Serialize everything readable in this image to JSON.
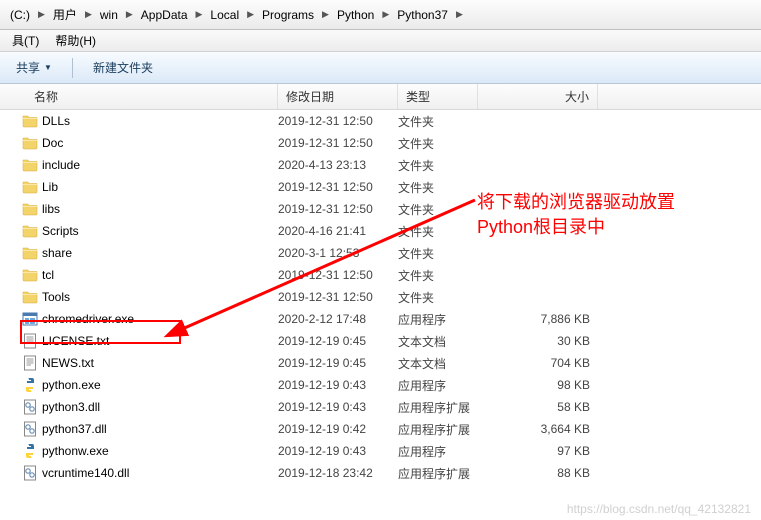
{
  "breadcrumb": {
    "drive": "(C:)",
    "items": [
      "用户",
      "win",
      "AppData",
      "Local",
      "Programs",
      "Python",
      "Python37"
    ]
  },
  "menubar": {
    "tools": "具(T)",
    "help": "帮助(H)"
  },
  "toolbar": {
    "share": "共享",
    "newfolder": "新建文件夹"
  },
  "columns": {
    "name": "名称",
    "date": "修改日期",
    "type": "类型",
    "size": "大小"
  },
  "files": [
    {
      "name": "DLLs",
      "date": "2019-12-31 12:50",
      "type": "文件夹",
      "size": "",
      "icon": "folder"
    },
    {
      "name": "Doc",
      "date": "2019-12-31 12:50",
      "type": "文件夹",
      "size": "",
      "icon": "folder"
    },
    {
      "name": "include",
      "date": "2020-4-13 23:13",
      "type": "文件夹",
      "size": "",
      "icon": "folder"
    },
    {
      "name": "Lib",
      "date": "2019-12-31 12:50",
      "type": "文件夹",
      "size": "",
      "icon": "folder"
    },
    {
      "name": "libs",
      "date": "2019-12-31 12:50",
      "type": "文件夹",
      "size": "",
      "icon": "folder"
    },
    {
      "name": "Scripts",
      "date": "2020-4-16 21:41",
      "type": "文件夹",
      "size": "",
      "icon": "folder"
    },
    {
      "name": "share",
      "date": "2020-3-1 12:53",
      "type": "文件夹",
      "size": "",
      "icon": "folder"
    },
    {
      "name": "tcl",
      "date": "2019-12-31 12:50",
      "type": "文件夹",
      "size": "",
      "icon": "folder"
    },
    {
      "name": "Tools",
      "date": "2019-12-31 12:50",
      "type": "文件夹",
      "size": "",
      "icon": "folder"
    },
    {
      "name": "chromedriver.exe",
      "date": "2020-2-12 17:48",
      "type": "应用程序",
      "size": "7,886 KB",
      "icon": "exe-win"
    },
    {
      "name": "LICENSE.txt",
      "date": "2019-12-19 0:45",
      "type": "文本文档",
      "size": "30 KB",
      "icon": "txt"
    },
    {
      "name": "NEWS.txt",
      "date": "2019-12-19 0:45",
      "type": "文本文档",
      "size": "704 KB",
      "icon": "txt"
    },
    {
      "name": "python.exe",
      "date": "2019-12-19 0:43",
      "type": "应用程序",
      "size": "98 KB",
      "icon": "python"
    },
    {
      "name": "python3.dll",
      "date": "2019-12-19 0:43",
      "type": "应用程序扩展",
      "size": "58 KB",
      "icon": "dll"
    },
    {
      "name": "python37.dll",
      "date": "2019-12-19 0:42",
      "type": "应用程序扩展",
      "size": "3,664 KB",
      "icon": "dll"
    },
    {
      "name": "pythonw.exe",
      "date": "2019-12-19 0:43",
      "type": "应用程序",
      "size": "97 KB",
      "icon": "python"
    },
    {
      "name": "vcruntime140.dll",
      "date": "2019-12-18 23:42",
      "type": "应用程序扩展",
      "size": "88 KB",
      "icon": "dll"
    }
  ],
  "annotation": {
    "line1": "将下载的浏览器驱动放置",
    "line2": "Python根目录中"
  },
  "watermark": "https://blog.csdn.net/qq_42132821"
}
